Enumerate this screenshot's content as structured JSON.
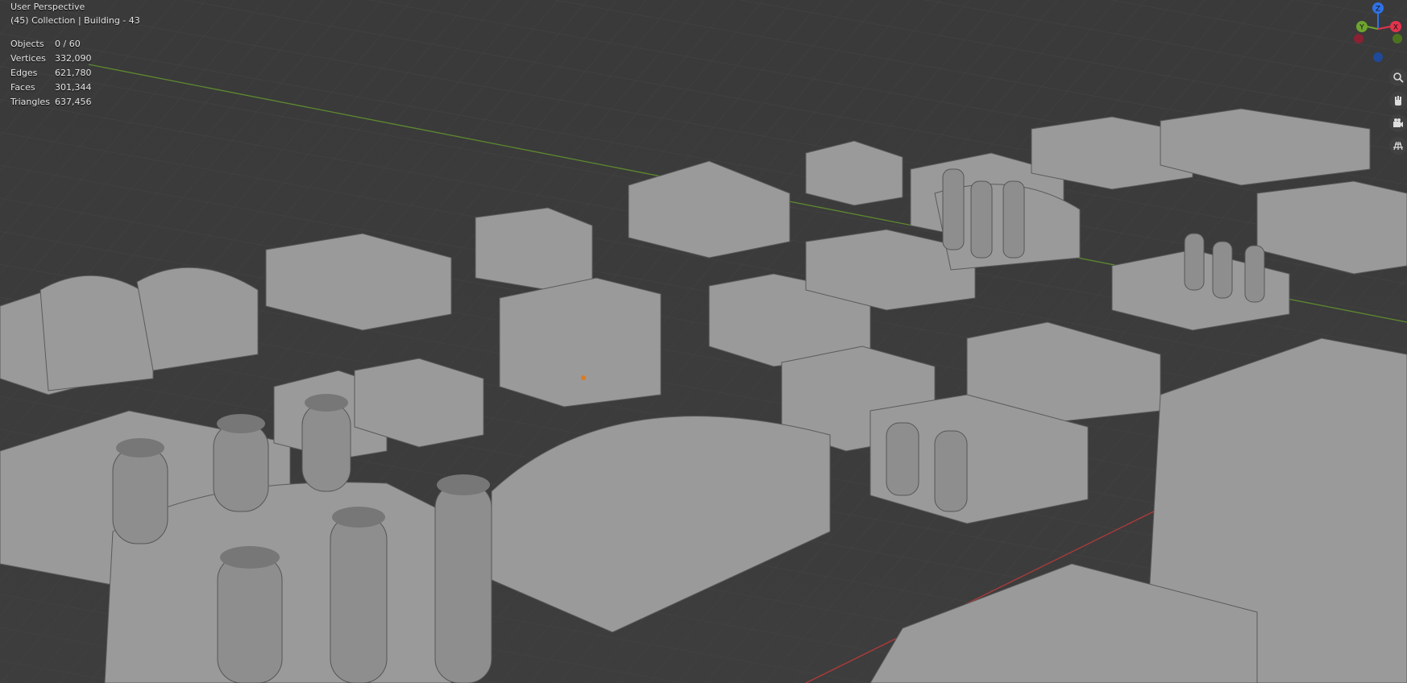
{
  "viewport": {
    "view_name": "User Perspective",
    "context": "(45) Collection | Building - 43"
  },
  "stats": [
    {
      "label": "Objects",
      "value": "0 / 60"
    },
    {
      "label": "Vertices",
      "value": "332,090"
    },
    {
      "label": "Edges",
      "value": "621,780"
    },
    {
      "label": "Faces",
      "value": "301,344"
    },
    {
      "label": "Triangles",
      "value": "637,456"
    }
  ],
  "gizmo": {
    "axes": [
      {
        "name": "Z",
        "color": "#2f72e6"
      },
      {
        "name": "Y",
        "color": "#6da52f"
      },
      {
        "name": "X",
        "color": "#e2334d"
      }
    ]
  },
  "nav_tools": [
    {
      "icon": "zoom-icon"
    },
    {
      "icon": "hand-pan-icon"
    },
    {
      "icon": "camera-icon"
    },
    {
      "icon": "grid-perspective-icon"
    }
  ],
  "colors": {
    "background": "#3c3c3c",
    "grid": "#454545",
    "x_axis": "#b43a3a",
    "y_axis": "#5d8a2f",
    "model": "#9a9a9a"
  }
}
